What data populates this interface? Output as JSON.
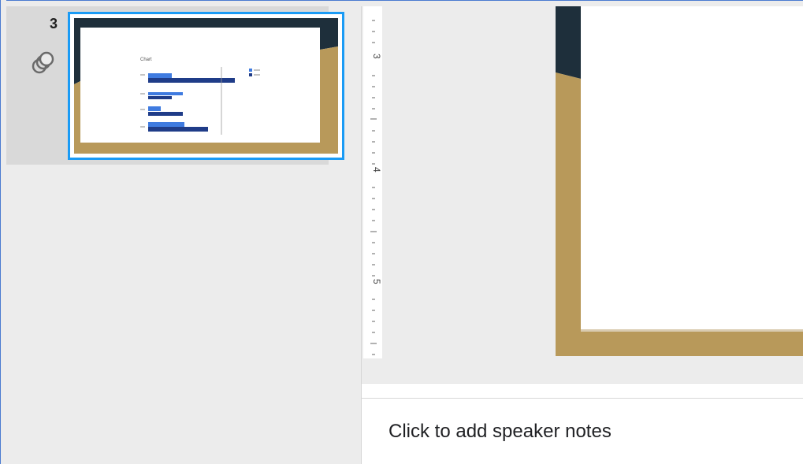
{
  "filmstrip": {
    "slides": [
      {
        "number": "3",
        "icon": "transition-icon",
        "selected": true
      }
    ]
  },
  "ruler": {
    "labels": [
      "3",
      "4",
      "5"
    ]
  },
  "notes": {
    "placeholder": "Click to add speaker notes"
  },
  "colors": {
    "selection": "#1a9bf5",
    "slide_dark": "#1e2f3b",
    "slide_gold": "#b8995a",
    "chart_dark_blue": "#1f3c88",
    "chart_light_blue": "#3f7be0"
  }
}
